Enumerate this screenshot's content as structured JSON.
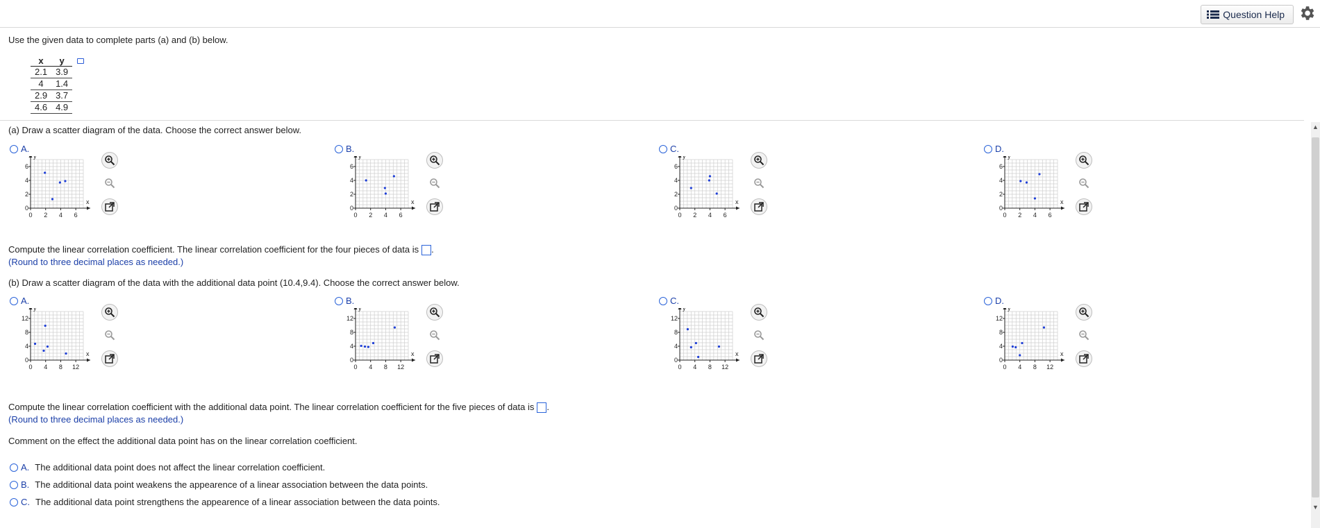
{
  "header": {
    "help_label": "Question Help",
    "help_icon": "list-icon",
    "settings_icon": "gear-icon"
  },
  "prompt": "Use the given data to complete parts (a) and (b) below.",
  "table": {
    "headers": [
      "x",
      "y"
    ],
    "rows": [
      [
        "2.1",
        "3.9"
      ],
      [
        "4",
        "1.4"
      ],
      [
        "2.9",
        "3.7"
      ],
      [
        "4.6",
        "4.9"
      ]
    ]
  },
  "part_a": {
    "question": "(a) Draw a scatter diagram of the data. Choose the correct answer below.",
    "options": [
      {
        "label": "A.",
        "points": [
          [
            1.9,
            5.1
          ],
          [
            3.9,
            3.7
          ],
          [
            4.6,
            3.9
          ],
          [
            2.9,
            1.3
          ]
        ]
      },
      {
        "label": "B.",
        "points": [
          [
            1.4,
            4.0
          ],
          [
            5.1,
            4.6
          ],
          [
            3.9,
            2.9
          ],
          [
            4.0,
            2.1
          ]
        ]
      },
      {
        "label": "C.",
        "points": [
          [
            4.0,
            4.6
          ],
          [
            3.9,
            4.0
          ],
          [
            1.5,
            2.9
          ],
          [
            4.9,
            2.1
          ]
        ]
      },
      {
        "label": "D.",
        "points": [
          [
            2.1,
            3.9
          ],
          [
            2.9,
            3.7
          ],
          [
            4.6,
            4.9
          ],
          [
            4.0,
            1.4
          ]
        ]
      }
    ],
    "correlation_prompt": "Compute the linear correlation coefficient. The linear correlation coefficient for the four pieces of data is",
    "round_note": "(Round to three decimal places as needed.)"
  },
  "part_b": {
    "question": "(b) Draw a scatter diagram of the data with the additional data point (10.4,9.4).  Choose the correct answer below.",
    "options": [
      {
        "label": "A.",
        "points": [
          [
            3.9,
            9.9
          ],
          [
            1.2,
            4.7
          ],
          [
            4.5,
            3.9
          ],
          [
            3.5,
            2.7
          ],
          [
            9.4,
            1.9
          ]
        ]
      },
      {
        "label": "B.",
        "points": [
          [
            2.5,
            3.9
          ],
          [
            3.4,
            3.8
          ],
          [
            4.7,
            4.9
          ],
          [
            10.4,
            9.4
          ],
          [
            1.5,
            4.1
          ]
        ]
      },
      {
        "label": "C.",
        "points": [
          [
            2.1,
            8.9
          ],
          [
            4.3,
            4.9
          ],
          [
            4.9,
            0.9
          ],
          [
            10.4,
            3.9
          ],
          [
            3.0,
            3.7
          ]
        ]
      },
      {
        "label": "D.",
        "points": [
          [
            2.1,
            3.9
          ],
          [
            4.0,
            1.4
          ],
          [
            2.9,
            3.7
          ],
          [
            4.6,
            4.9
          ],
          [
            10.4,
            9.4
          ]
        ]
      }
    ],
    "correlation_prompt": "Compute the linear correlation coefficient with the additional data point. The linear correlation coefficient for the five pieces of data is",
    "round_note": "(Round to three decimal places as needed.)",
    "comment_prompt": "Comment on the effect the additional data point has on the linear correlation coefficient.",
    "choices": [
      {
        "label": "A.",
        "text": "The additional data point does not affect the linear correlation coefficient."
      },
      {
        "label": "B.",
        "text": "The additional data point weakens the appearence of a linear association between the data points."
      },
      {
        "label": "C.",
        "text": "The additional data point strengthens the appearence of a linear association between the data points."
      }
    ]
  },
  "graph_a": {
    "x_ticks": [
      "0",
      "2",
      "4",
      "6"
    ],
    "y_ticks": [
      "6",
      "4",
      "2",
      "0"
    ],
    "x_label": "x",
    "y_label": "y",
    "xlim": [
      0,
      7
    ],
    "ylim": [
      0,
      7
    ]
  },
  "graph_b": {
    "x_ticks": [
      "0",
      "4",
      "8",
      "12"
    ],
    "y_ticks": [
      "12",
      "8",
      "4",
      "0"
    ],
    "x_label": "x",
    "y_label": "y",
    "xlim": [
      0,
      14
    ],
    "ylim": [
      0,
      14
    ]
  },
  "tools": {
    "zoom_in": "zoom-in-icon",
    "zoom_out": "zoom-out-icon",
    "popout": "popout-icon"
  },
  "colors": {
    "accent": "#1b3fa8",
    "point": "#1f3fd6"
  }
}
